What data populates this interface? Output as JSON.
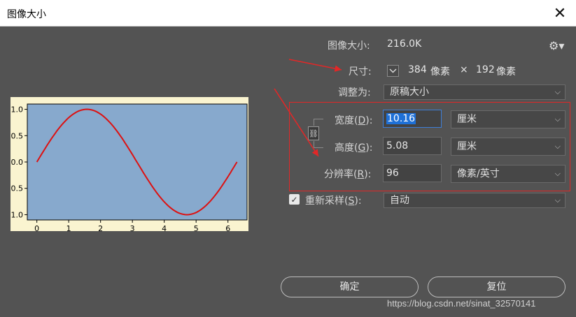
{
  "window": {
    "title": "图像大小",
    "close_glyph": "✕"
  },
  "image_size": {
    "label": "图像大小:",
    "value": "216.0K"
  },
  "dimensions": {
    "label": "尺寸:",
    "width": "384",
    "unit1": "像素",
    "times": "×",
    "height": "192",
    "unit2": "像素"
  },
  "fit_to": {
    "label": "调整为:",
    "value": "原稿大小"
  },
  "width": {
    "label": "宽度",
    "key": "D",
    "value": "10.16",
    "unit": "厘米"
  },
  "height": {
    "label": "高度",
    "key": "G",
    "value": "5.08",
    "unit": "厘米"
  },
  "resolution": {
    "label": "分辨率",
    "key": "R",
    "value": "96",
    "unit": "像素/英寸"
  },
  "resample": {
    "label": "重新采样",
    "key": "S",
    "checked": true,
    "value": "自动"
  },
  "buttons": {
    "ok": "确定",
    "reset": "复位"
  },
  "watermark": "https://blog.csdn.net/sinat_32570141",
  "colors": {
    "annotation_red": "#e22727",
    "accent_blue": "#1e70d7",
    "plot_bg": "#87a9cd",
    "preview_bg": "#faf4d0",
    "curve": "#dd1111"
  },
  "chart_data": {
    "type": "line",
    "series": [
      {
        "x": [
          0,
          0.5,
          1,
          1.5708,
          2,
          2.5,
          3,
          3.1416,
          3.5,
          4,
          4.5,
          4.7124,
          5,
          5.5,
          6,
          6.2832
        ],
        "y": [
          0,
          0.479,
          0.841,
          1.0,
          0.909,
          0.598,
          0.141,
          0,
          -0.351,
          -0.757,
          -0.978,
          -1.0,
          -0.959,
          -0.706,
          -0.279,
          0
        ]
      }
    ],
    "x_ticks": [
      "0",
      "1",
      "2",
      "3",
      "4",
      "5",
      "6"
    ],
    "y_ticks": [
      ".1.0",
      "0.5",
      "0.0",
      "0.5",
      "1.0"
    ],
    "xlim": [
      -0.3,
      6.6
    ],
    "ylim": [
      -1.1,
      1.1
    ]
  }
}
